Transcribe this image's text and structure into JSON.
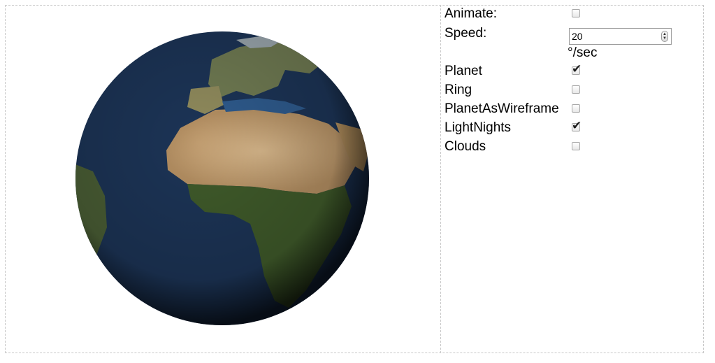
{
  "controls": {
    "animate": {
      "label": "Animate:",
      "checked": false
    },
    "speed": {
      "label": "Speed:",
      "value": "20",
      "unit": "°/sec"
    },
    "options": [
      {
        "label": "Planet",
        "checked": true
      },
      {
        "label": "Ring",
        "checked": false
      },
      {
        "label": "PlanetAsWireframe",
        "checked": false
      },
      {
        "label": "LightNights",
        "checked": true
      },
      {
        "label": "Clouds",
        "checked": false
      }
    ]
  },
  "icons": {
    "checkmark": "✔",
    "spin_up": "▲",
    "spin_down": "▼"
  },
  "colors": {
    "ocean": "#1c3456",
    "ocean_shallow": "#2e5a8c",
    "desert": "#c9a67a",
    "vegetation": "#3f5a2a",
    "border": "#c8c8c8"
  }
}
